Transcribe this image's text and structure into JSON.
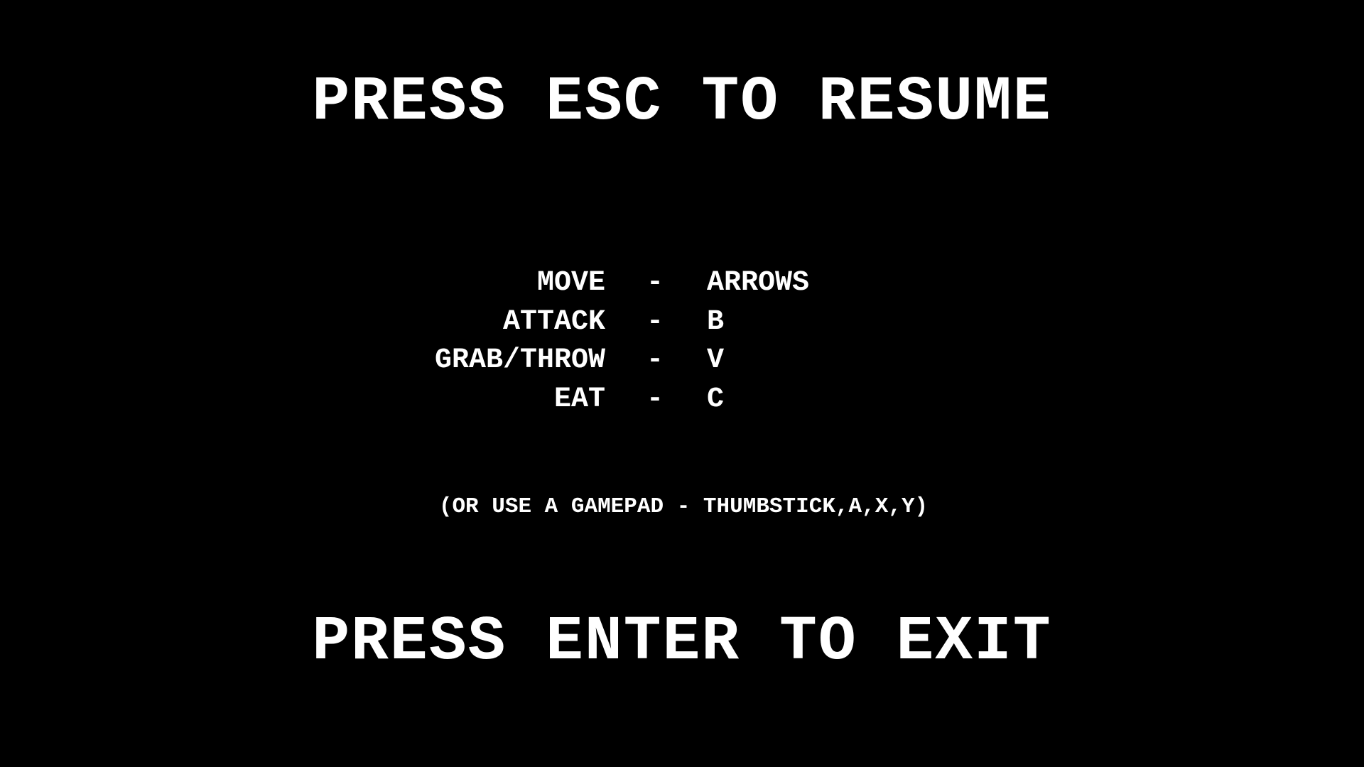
{
  "pause_menu": {
    "resume_prompt": "PRESS ESC TO RESUME",
    "exit_prompt": "PRESS ENTER TO EXIT",
    "separator": "-",
    "controls": [
      {
        "action": "MOVE",
        "key": "ARROWS"
      },
      {
        "action": "ATTACK",
        "key": "B"
      },
      {
        "action": "GRAB/THROW",
        "key": "V"
      },
      {
        "action": "EAT",
        "key": "C"
      }
    ],
    "gamepad_hint": "(OR USE A GAMEPAD - THUMBSTICK,A,X,Y)",
    "colors": {
      "background": "#000000",
      "text": "#ffffff"
    }
  }
}
